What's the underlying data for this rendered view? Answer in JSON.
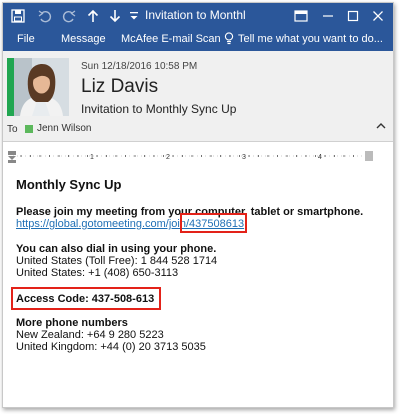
{
  "titlebar": {
    "title": "Invitation to Monthl",
    "controls": [
      "save-icon",
      "undo-icon",
      "redo-icon",
      "up-arrow-icon",
      "down-arrow-icon",
      "more-icon"
    ]
  },
  "ribbon": {
    "tabs": [
      "File",
      "Message",
      "McAfee E-mail Scan"
    ],
    "tell_me": "Tell me what you want to do..."
  },
  "header": {
    "date": "Sun 12/18/2016 10:58 PM",
    "sender": "Liz Davis",
    "subject": "Invitation to Monthly Sync Up",
    "to_label": "To",
    "recipient": "Jenn Wilson"
  },
  "body": {
    "heading": "Monthly Sync Up",
    "join_text": "Please join my meeting from your computer, tablet or smartphone.",
    "join_url": "https://global.gotomeeting.com/join/",
    "meeting_id": "437508613",
    "dial_text": "You can also dial in using your phone.",
    "us_toll_free": "United States (Toll Free): 1 844 528 1714",
    "us_number": "United States: +1 (408) 650-3113",
    "access_code": "Access Code: 437-508-613",
    "more_numbers": "More phone numbers",
    "nz_number": "New Zealand: +64 9 280 5223",
    "uk_number": "United Kingdom: +44 (0) 20 3713 5035"
  },
  "colors": {
    "title_bar": "#2b579a",
    "highlight_box": "#e32219",
    "link": "#1f6fb5"
  }
}
